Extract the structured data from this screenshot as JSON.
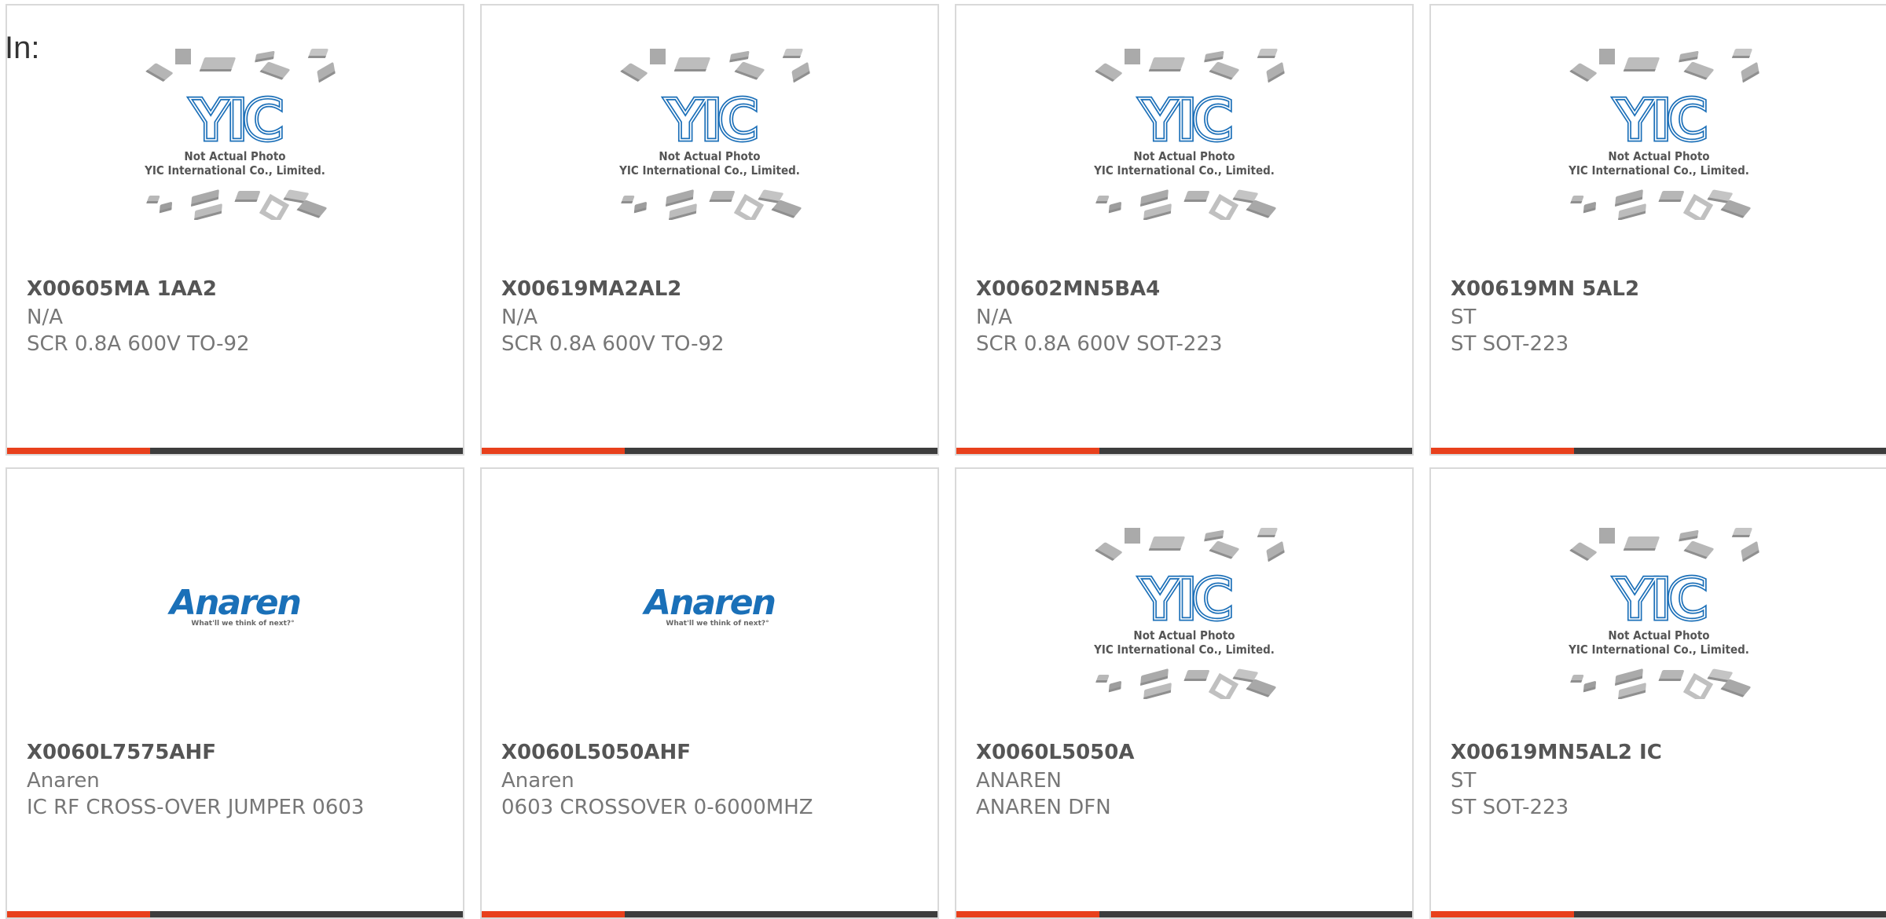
{
  "page": {
    "in_label": "In:"
  },
  "colors": {
    "accent": "#e8401c",
    "bar_dark": "#3d3d3d",
    "yic_blue": "#1b6fb8",
    "anaren_blue": "#1a70b8"
  },
  "placeholder": {
    "line1": "Not Actual Photo",
    "line2": "YIC International Co., Limited.",
    "logo_text": "YIC"
  },
  "anaren_logo": {
    "brand": "Anaren",
    "tagline": "What'll we think of next?°"
  },
  "products": [
    {
      "name": "X00605MA 1AA2",
      "manufacturer": "N/A",
      "description": "SCR 0.8A 600V TO-92",
      "image": "yic-placeholder"
    },
    {
      "name": "X00619MA2AL2",
      "manufacturer": "N/A",
      "description": "SCR 0.8A 600V TO-92",
      "image": "yic-placeholder"
    },
    {
      "name": "X00602MN5BA4",
      "manufacturer": "N/A",
      "description": "SCR 0.8A 600V SOT-223",
      "image": "yic-placeholder"
    },
    {
      "name": "X00619MN 5AL2",
      "manufacturer": "ST",
      "description": "ST SOT-223",
      "image": "yic-placeholder"
    },
    {
      "name": "X0060L7575AHF",
      "manufacturer": "Anaren",
      "description": "IC RF CROSS-OVER JUMPER 0603",
      "image": "anaren-logo"
    },
    {
      "name": "X0060L5050AHF",
      "manufacturer": "Anaren",
      "description": "0603 CROSSOVER 0-6000MHZ",
      "image": "anaren-logo"
    },
    {
      "name": "X0060L5050A",
      "manufacturer": "ANAREN",
      "description": "ANAREN DFN",
      "image": "yic-placeholder"
    },
    {
      "name": "X00619MN5AL2 IC",
      "manufacturer": "ST",
      "description": "ST SOT-223",
      "image": "yic-placeholder"
    }
  ]
}
